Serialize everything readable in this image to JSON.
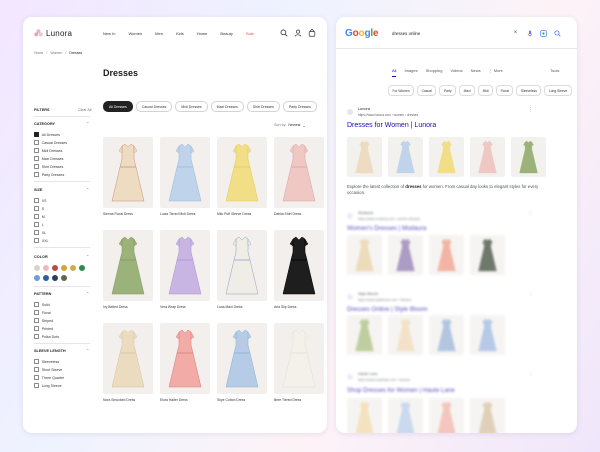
{
  "shop": {
    "brand": "Lunora",
    "nav": [
      "New In",
      "Women",
      "Men",
      "Kids",
      "Home",
      "Beauty",
      "Sale"
    ],
    "breadcrumb": [
      "Home",
      "/",
      "Women",
      "/",
      "Dresses"
    ],
    "page_title": "Dresses",
    "chips": [
      "All Dresses",
      "Casual Dresses",
      "Midi Dresses",
      "Maxi Dresses",
      "Shirt Dresses",
      "Party Dresses"
    ],
    "sort_label": "Sort by:",
    "sort_value": "Newest",
    "filters_label": "FILTERS",
    "clear_all": "Clear All",
    "category": {
      "label": "CATEGORY",
      "options": [
        "All Dresses",
        "Casual Dresses",
        "Midi Dresses",
        "Maxi Dresses",
        "Shirt Dresses",
        "Party Dresses"
      ]
    },
    "size": {
      "label": "SIZE",
      "options": [
        "XS",
        "S",
        "M",
        "L",
        "XL",
        "XXL"
      ]
    },
    "color": {
      "label": "COLOR",
      "swatches": [
        "#d9d3c9",
        "#f0b8c4",
        "#b84a4a",
        "#d6a23a",
        "#c9b04a",
        "#2e8a4d",
        "#6b9fd6",
        "#2f5aa8",
        "#2e3b66",
        "#5a6b4a"
      ]
    },
    "pattern": {
      "label": "PATTERN",
      "options": [
        "Solid",
        "Floral",
        "Striped",
        "Printed",
        "Polka Dots"
      ]
    },
    "sleeve": {
      "label": "SLEEVE LENGTH",
      "options": [
        "Sleeveless",
        "Short Sleeve",
        "Three Quarter",
        "Long Sleeve"
      ]
    },
    "products": [
      {
        "name": "Sienna Floral Dress",
        "color": "#eddcc2",
        "accent": "#c98f7a"
      },
      {
        "name": "Lucia Tiered Midi Dress",
        "color": "#bfd4ea",
        "accent": "#9ab8d8"
      },
      {
        "name": "Milo Puff Sleeve Dress",
        "color": "#f1de86",
        "accent": "#e2c95a"
      },
      {
        "name": "Dahlia Shirt Dress",
        "color": "#efc8c4",
        "accent": "#d9a4a0"
      },
      {
        "name": "Ivy Belted Dress",
        "color": "#9bb37a",
        "accent": "#7c9659"
      },
      {
        "name": "Vera Wrap Dress",
        "color": "#c8b5e4",
        "accent": "#a892cf"
      },
      {
        "name": "Luna Maxi Dress",
        "color": "#f0ede6",
        "accent": "#8aa0c2"
      },
      {
        "name": "Aria Slip Dress",
        "color": "#1e1e1e",
        "accent": "#000000"
      },
      {
        "name": "Nora Smocked Dress",
        "color": "#ebdcc0",
        "accent": "#d6c4a2"
      },
      {
        "name": "Elora Halter Dress",
        "color": "#f2aba6",
        "accent": "#d97c76"
      },
      {
        "name": "Skye Cotton Dress",
        "color": "#b5cbe6",
        "accent": "#8fb0d6"
      },
      {
        "name": "Bree Tiered Dress",
        "color": "#f3f1ea",
        "accent": "#e3dfd4"
      }
    ]
  },
  "serp": {
    "query": "dresses online",
    "tabs": [
      "All",
      "Images",
      "Shopping",
      "Videos",
      "News",
      "⋮ More"
    ],
    "tools": "Tools",
    "refinements": [
      "For Women",
      "Casual",
      "Party",
      "Maxi",
      "Midi",
      "Floral",
      "Sleeveless",
      "Long Sleeve"
    ],
    "results": [
      {
        "site": "Lunora",
        "url": "https://www.lunora.com › women › dresses",
        "title": "Dresses for Women | Lunora",
        "snippet_pre": "Explore the latest collection of ",
        "snippet_bold": "dresses",
        "snippet_post": " for women. From casual day looks to elegant styles for every occasion.",
        "thumbs": [
          "#eddcc2",
          "#bfd4ea",
          "#f1de86",
          "#efc8c4",
          "#9bb37a"
        ]
      },
      {
        "site": "Modaura",
        "url": "https://www.modaura.com › women-dresses",
        "title": "Women's Dresses | Modaura",
        "thumbs": [
          "#e8cfa5",
          "#8f7bb0",
          "#ee9d86",
          "#3f4b3a"
        ]
      },
      {
        "site": "Style Bloom",
        "url": "https://www.stylebloom.com › dresses",
        "title": "Dresses Online | Style Bloom",
        "thumbs": [
          "#a9bf7f",
          "#efd9b8",
          "#9ab4d8",
          "#9fb7e0"
        ]
      },
      {
        "site": "Haute Lane",
        "url": "https://www.hautelane.com › dresses",
        "title": "Shop Dresses for Women | Haute Lane",
        "thumbs": [
          "#f0d9a8",
          "#b9cde8",
          "#f2b3a8",
          "#d8c1a2"
        ]
      }
    ]
  }
}
